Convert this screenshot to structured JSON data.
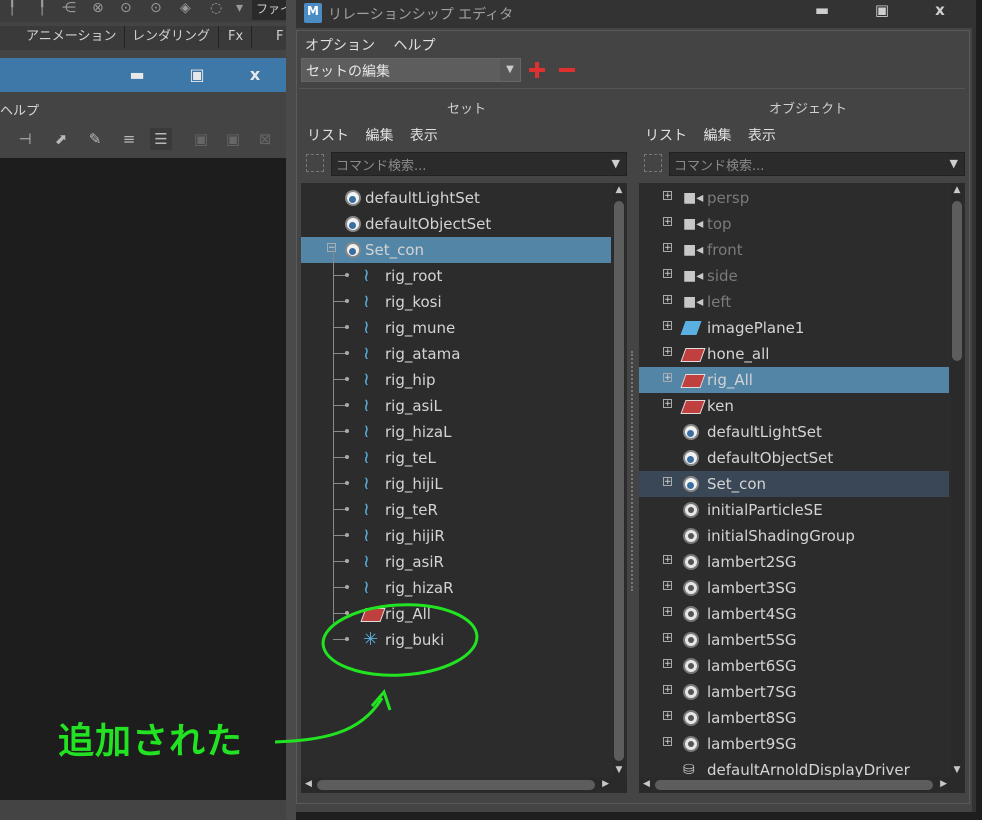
{
  "background_window": {
    "toolbar_cut_label": "ファイ",
    "tabs": [
      "アニメーション",
      "レンダリング",
      "Fx",
      "F"
    ],
    "menu_cut_label": "ヘルプ",
    "win_buttons": {
      "minimize": "▬",
      "maximize": "▣",
      "close": "x"
    }
  },
  "editor": {
    "logo": "M",
    "title": "リレーションシップ エディタ",
    "win_buttons": {
      "minimize": "▬",
      "maximize": "▣",
      "close": "x"
    },
    "menu": {
      "options": "オプション",
      "help": "ヘルプ"
    },
    "mode_dropdown": {
      "value": "セットの編集"
    },
    "add_icon": "plus-icon",
    "remove_icon": "minus-icon",
    "left_pane": {
      "label": "セット",
      "menu": [
        "リスト",
        "編集",
        "表示"
      ],
      "search_placeholder": "コマンド検索...",
      "items": [
        {
          "label": "defaultLightSet",
          "icon": "set",
          "indent": 0
        },
        {
          "label": "defaultObjectSet",
          "icon": "set",
          "indent": 0
        },
        {
          "label": "Set_con",
          "icon": "set",
          "indent": 0,
          "expanded": "⊟",
          "selected": true
        },
        {
          "label": "rig_root",
          "icon": "joint",
          "indent": 1
        },
        {
          "label": "rig_kosi",
          "icon": "joint",
          "indent": 1
        },
        {
          "label": "rig_mune",
          "icon": "joint",
          "indent": 1
        },
        {
          "label": "rig_atama",
          "icon": "joint",
          "indent": 1
        },
        {
          "label": "rig_hip",
          "icon": "joint",
          "indent": 1
        },
        {
          "label": "rig_asiL",
          "icon": "joint",
          "indent": 1
        },
        {
          "label": "rig_hizaL",
          "icon": "joint",
          "indent": 1
        },
        {
          "label": "rig_teL",
          "icon": "joint",
          "indent": 1
        },
        {
          "label": "rig_hijiL",
          "icon": "joint",
          "indent": 1
        },
        {
          "label": "rig_teR",
          "icon": "joint",
          "indent": 1
        },
        {
          "label": "rig_hijiR",
          "icon": "joint",
          "indent": 1
        },
        {
          "label": "rig_asiR",
          "icon": "joint",
          "indent": 1
        },
        {
          "label": "rig_hizaR",
          "icon": "joint",
          "indent": 1
        },
        {
          "label": "rig_All",
          "icon": "mesh",
          "indent": 1
        },
        {
          "label": "rig_buki",
          "icon": "star",
          "indent": 1
        }
      ]
    },
    "right_pane": {
      "label": "オブジェクト",
      "menu": [
        "リスト",
        "編集",
        "表示"
      ],
      "search_placeholder": "コマンド検索...",
      "items": [
        {
          "label": "persp",
          "icon": "cam",
          "expander": "+",
          "dim": true
        },
        {
          "label": "top",
          "icon": "cam",
          "expander": "+",
          "dim": true
        },
        {
          "label": "front",
          "icon": "cam",
          "expander": "+",
          "dim": true
        },
        {
          "label": "side",
          "icon": "cam",
          "expander": "+",
          "dim": true
        },
        {
          "label": "left",
          "icon": "cam",
          "expander": "+",
          "dim": true
        },
        {
          "label": "imagePlane1",
          "icon": "plane",
          "expander": "+"
        },
        {
          "label": "hone_all",
          "icon": "mesh",
          "expander": "+"
        },
        {
          "label": "rig_All",
          "icon": "mesh",
          "expander": "+",
          "selected": true
        },
        {
          "label": "ken",
          "icon": "mesh",
          "expander": "+"
        },
        {
          "label": "defaultLightSet",
          "icon": "set"
        },
        {
          "label": "defaultObjectSet",
          "icon": "set"
        },
        {
          "label": "Set_con",
          "icon": "set",
          "expander": "+",
          "selected_dim": true
        },
        {
          "label": "initialParticleSE",
          "icon": "sg"
        },
        {
          "label": "initialShadingGroup",
          "icon": "sg"
        },
        {
          "label": "lambert2SG",
          "icon": "sg",
          "expander": "+"
        },
        {
          "label": "lambert3SG",
          "icon": "sg",
          "expander": "+"
        },
        {
          "label": "lambert4SG",
          "icon": "sg",
          "expander": "+"
        },
        {
          "label": "lambert5SG",
          "icon": "sg",
          "expander": "+"
        },
        {
          "label": "lambert6SG",
          "icon": "sg",
          "expander": "+"
        },
        {
          "label": "lambert7SG",
          "icon": "sg",
          "expander": "+"
        },
        {
          "label": "lambert8SG",
          "icon": "sg",
          "expander": "+"
        },
        {
          "label": "lambert9SG",
          "icon": "sg",
          "expander": "+"
        },
        {
          "label": "defaultArnoldDisplayDriver",
          "icon": "drv"
        }
      ]
    },
    "scroll_arrows": {
      "up": "▲",
      "down": "▼",
      "left": "◀",
      "right": "▶"
    }
  },
  "annotation": {
    "text": "追加された",
    "color": "#22e322"
  },
  "colors": {
    "selection": "#5285a6",
    "selection_dim": "#3a4756",
    "title_bar_active": "#3e78a8"
  }
}
